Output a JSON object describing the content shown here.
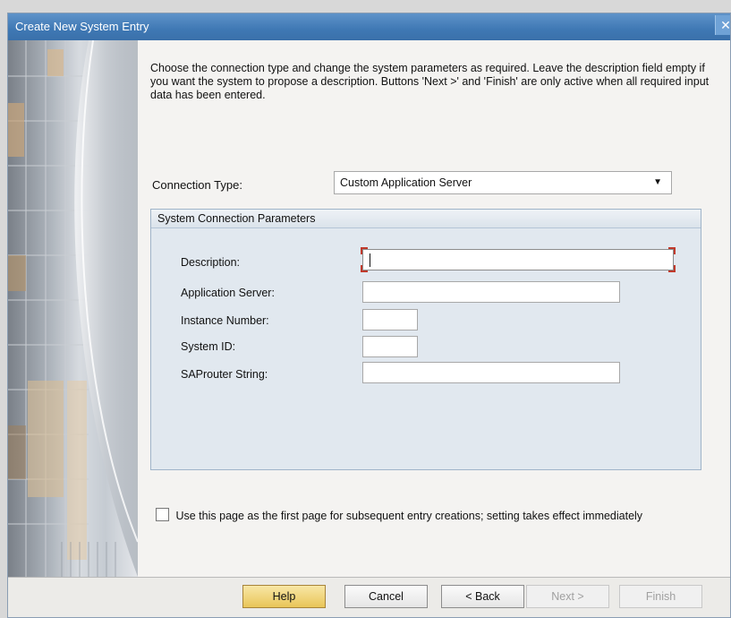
{
  "window": {
    "title": "Create New System Entry",
    "close_glyph": "✕"
  },
  "intro": {
    "text": "Choose the connection type and change the system parameters as required. Leave the description field empty if you want the system to propose a description. Buttons 'Next >' and 'Finish' are only active when all required input data has been entered."
  },
  "connection_type": {
    "label": "Connection Type:",
    "value": "Custom Application Server"
  },
  "group": {
    "title": "System Connection Parameters",
    "fields": [
      {
        "label": "Description:",
        "value": ""
      },
      {
        "label": "Application Server:",
        "value": ""
      },
      {
        "label": "Instance Number:",
        "value": ""
      },
      {
        "label": "System ID:",
        "value": ""
      },
      {
        "label": "SAProuter String:",
        "value": ""
      }
    ]
  },
  "first_page_option": {
    "label": "Use this page as the first page for subsequent entry creations; setting takes effect immediately",
    "checked": false
  },
  "buttons": {
    "help": "Help",
    "cancel": "Cancel",
    "back": "< Back",
    "next": "Next >",
    "finish": "Finish"
  },
  "colors": {
    "titlebar": "#3f78b4",
    "group_background": "#e1e8ef",
    "primary_button": "#e9c558",
    "focus_corner": "#c0392b"
  }
}
